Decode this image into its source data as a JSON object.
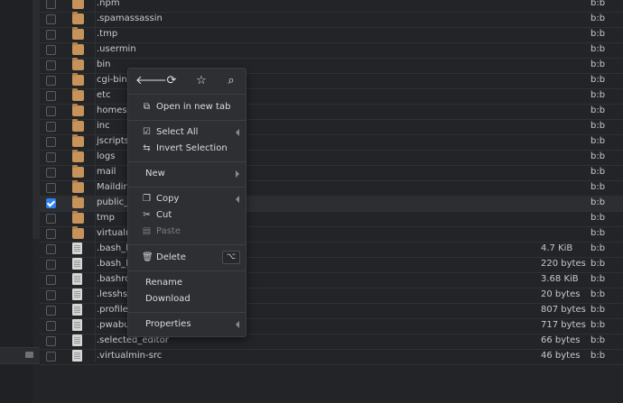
{
  "colors": {
    "folder": "#c8935a",
    "accent": "#2f80ed",
    "background": "#222427",
    "menu": "#2d2f33"
  },
  "rows": [
    {
      "name": ".npm",
      "type": "folder",
      "size": "",
      "owner": "b:b",
      "checked": false
    },
    {
      "name": ".spamassassin",
      "type": "folder",
      "size": "",
      "owner": "b:b",
      "checked": false
    },
    {
      "name": ".tmp",
      "type": "folder",
      "size": "",
      "owner": "b:b",
      "checked": false
    },
    {
      "name": ".usermin",
      "type": "folder",
      "size": "",
      "owner": "b:b",
      "checked": false
    },
    {
      "name": "bin",
      "type": "folder",
      "size": "",
      "owner": "b:b",
      "checked": false
    },
    {
      "name": "cgi-bin",
      "type": "folder",
      "size": "",
      "owner": "b:b",
      "checked": false
    },
    {
      "name": "etc",
      "type": "folder",
      "size": "",
      "owner": "b:b",
      "checked": false
    },
    {
      "name": "homes",
      "type": "folder",
      "size": "",
      "owner": "b:b",
      "checked": false
    },
    {
      "name": "inc",
      "type": "folder",
      "size": "",
      "owner": "b:b",
      "checked": false
    },
    {
      "name": "jscripts",
      "type": "folder",
      "size": "",
      "owner": "b:b",
      "checked": false
    },
    {
      "name": "logs",
      "type": "folder",
      "size": "",
      "owner": "b:b",
      "checked": false
    },
    {
      "name": "mail",
      "type": "folder",
      "size": "",
      "owner": "b:b",
      "checked": false
    },
    {
      "name": "Maildir",
      "type": "folder",
      "size": "",
      "owner": "b:b",
      "checked": false
    },
    {
      "name": "public_h",
      "type": "folder",
      "size": "",
      "owner": "b:b",
      "checked": true
    },
    {
      "name": "tmp",
      "type": "folder",
      "size": "",
      "owner": "b:b",
      "checked": false
    },
    {
      "name": "virtualm",
      "type": "folder",
      "size": "",
      "owner": "b:b",
      "checked": false
    },
    {
      "name": ".bash_h",
      "type": "file",
      "size": "4.7 KiB",
      "owner": "b:b",
      "checked": false
    },
    {
      "name": ".bash_lo",
      "type": "file",
      "size": "220 bytes",
      "owner": "b:b",
      "checked": false
    },
    {
      "name": ".bashrc",
      "type": "file",
      "size": "3.68 KiB",
      "owner": "b:b",
      "checked": false
    },
    {
      "name": ".lesshst",
      "type": "file",
      "size": "20 bytes",
      "owner": "b:b",
      "checked": false
    },
    {
      "name": ".profile",
      "type": "file",
      "size": "807 bytes",
      "owner": "b:b",
      "checked": false
    },
    {
      "name": ".pwabui",
      "type": "file",
      "size": "717 bytes",
      "owner": "b:b",
      "checked": false
    },
    {
      "name": ".selected_editor",
      "type": "file",
      "size": "66 bytes",
      "owner": "b:b",
      "checked": false
    },
    {
      "name": ".virtualmin-src",
      "type": "file",
      "size": "46 bytes",
      "owner": "b:b",
      "checked": false
    }
  ],
  "menu": {
    "toolbar": [
      {
        "icon": "arrow-left-icon",
        "glyph": "🡐"
      },
      {
        "icon": "refresh-icon",
        "glyph": "⟳"
      },
      {
        "icon": "star-icon",
        "glyph": "☆"
      },
      {
        "icon": "search-icon",
        "glyph": "⌕"
      }
    ],
    "open_new_tab": "Open in new tab",
    "select_all": "Select All",
    "invert_selection": "Invert Selection",
    "new": "New",
    "copy": "Copy",
    "cut": "Cut",
    "paste": "Paste",
    "delete": "Delete",
    "delete_key": "⌥",
    "rename": "Rename",
    "download": "Download",
    "properties": "Properties"
  }
}
